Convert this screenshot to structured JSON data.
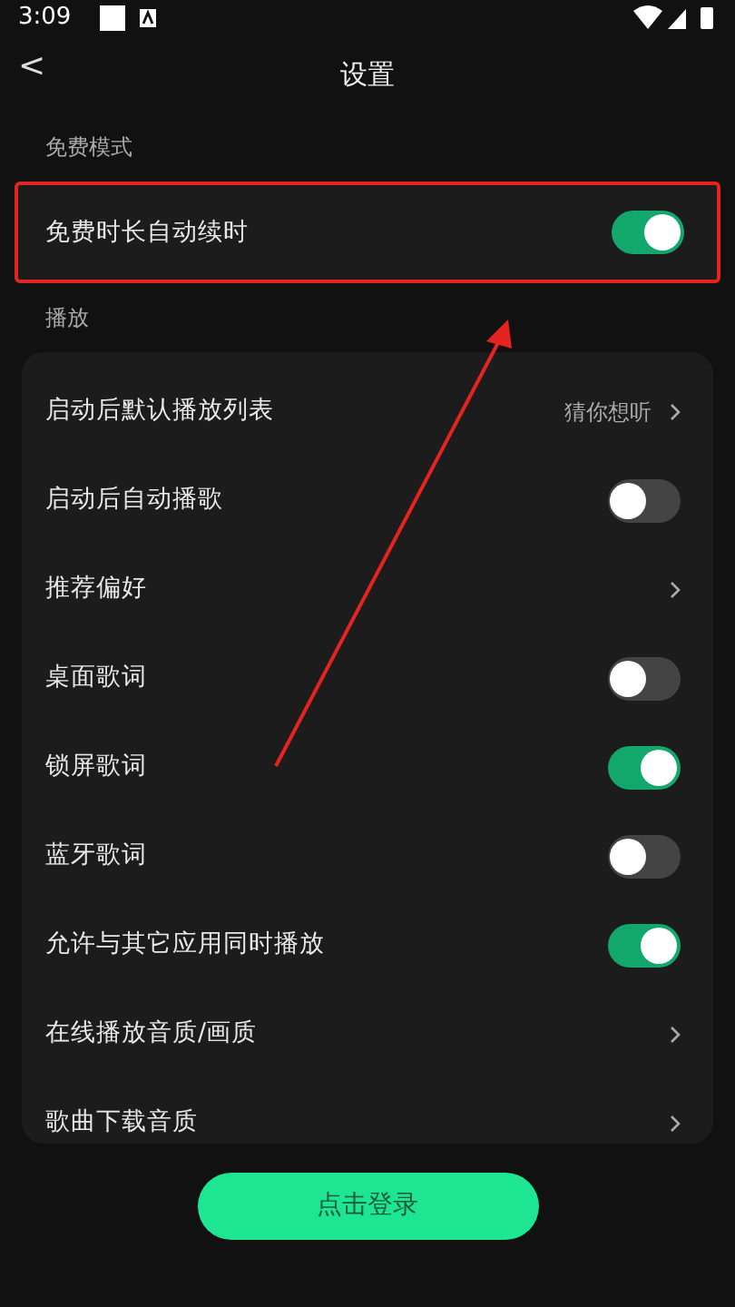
{
  "status_bar": {
    "time": "3:09"
  },
  "header": {
    "back": "<",
    "title": "设置"
  },
  "sections": [
    {
      "title": "免费模式",
      "highlighted": true,
      "items": [
        {
          "kind": "toggle",
          "label": "免费时长自动续时",
          "on": true
        }
      ]
    },
    {
      "title": "播放",
      "highlighted": false,
      "items": [
        {
          "kind": "value",
          "label": "启动后默认播放列表",
          "value": "猜你想听"
        },
        {
          "kind": "toggle",
          "label": "启动后自动播歌",
          "on": false
        },
        {
          "kind": "link",
          "label": "推荐偏好"
        },
        {
          "kind": "toggle",
          "label": "桌面歌词",
          "on": false
        },
        {
          "kind": "toggle",
          "label": "锁屏歌词",
          "on": true
        },
        {
          "kind": "toggle",
          "label": "蓝牙歌词",
          "on": false
        },
        {
          "kind": "toggle",
          "label": "允许与其它应用同时播放",
          "on": true
        },
        {
          "kind": "link",
          "label": "在线播放音质/画质"
        },
        {
          "kind": "link",
          "label": "歌曲下载音质"
        }
      ]
    }
  ],
  "login_button": "点击登录"
}
